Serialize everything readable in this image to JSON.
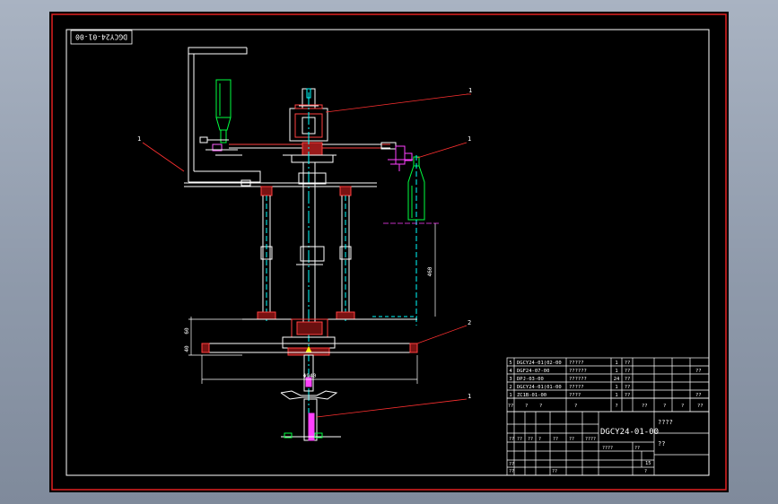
{
  "drawing": {
    "code_stamp": "DGCY24-01-00",
    "title_block": {
      "drawing_number": "DGCY24-01-00",
      "name": "????",
      "material": "??",
      "sheet_count": "15",
      "bom_rows": [
        {
          "seq": "5",
          "code": "DGCY24-01(02-00",
          "name": "?????",
          "qty": "1",
          "material": "??",
          "note": ""
        },
        {
          "seq": "4",
          "code": "DGF24-07-00",
          "name": "??????",
          "qty": "1",
          "material": "??",
          "note": "??"
        },
        {
          "seq": "3",
          "code": "DPJ-03-00",
          "name": "??????",
          "qty": "24",
          "material": "??",
          "note": ""
        },
        {
          "seq": "2",
          "code": "DGCY24-01(01-00",
          "name": "?????",
          "qty": "1",
          "material": "??",
          "note": ""
        },
        {
          "seq": "1",
          "code": "ZC1B-01-00",
          "name": "????",
          "qty": "1",
          "material": "??",
          "note": "??"
        }
      ],
      "header_row": [
        "??",
        "?",
        "?",
        "?",
        "?",
        "??",
        "?",
        "?",
        "??"
      ],
      "sign_row": [
        "??",
        "??",
        "??",
        "?",
        "??",
        "??",
        "??",
        "??"
      ],
      "bottom_row": [
        "??",
        "??",
        "??"
      ],
      "scale_row": [
        "????",
        "??",
        "?"
      ]
    },
    "callouts": [
      "1",
      "1",
      "1",
      "2",
      "1"
    ],
    "dimensions": {
      "overall_width": "Φ940",
      "bottle_height": "460",
      "level_a": "60",
      "level_b": "40"
    }
  }
}
